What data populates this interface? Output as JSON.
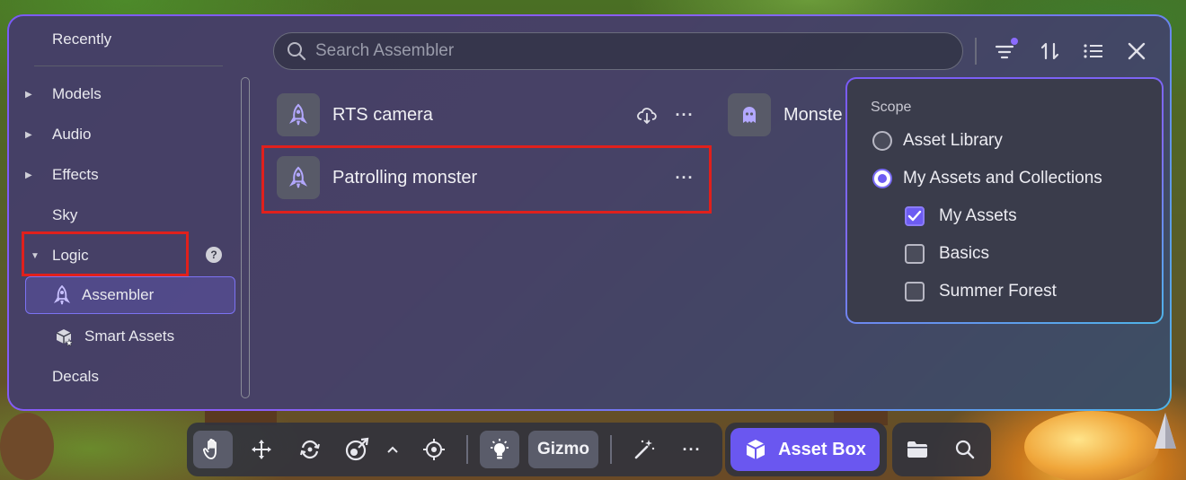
{
  "sidebar": {
    "recently": "Recently",
    "items": [
      {
        "label": "Models",
        "expandable": true
      },
      {
        "label": "Audio",
        "expandable": true
      },
      {
        "label": "Effects",
        "expandable": true
      },
      {
        "label": "Sky",
        "expandable": false
      },
      {
        "label": "Logic",
        "expanded": true
      }
    ],
    "logic_children": [
      {
        "label": "Assembler",
        "icon": "rocket-icon",
        "selected": true
      },
      {
        "label": "Smart Assets",
        "icon": "smart-assets-icon"
      }
    ],
    "decals": "Decals",
    "help": "?"
  },
  "search": {
    "placeholder": "Search Assembler"
  },
  "assets": [
    {
      "name": "RTS camera",
      "icon": "rocket-icon"
    },
    {
      "name": "Monste",
      "icon": "ghost-icon"
    },
    {
      "name": "Patrolling monster",
      "icon": "rocket-icon"
    }
  ],
  "scope": {
    "title": "Scope",
    "options": [
      {
        "label": "Asset Library",
        "selected": false
      },
      {
        "label": "My Assets and Collections",
        "selected": true
      }
    ],
    "collections": [
      {
        "label": "My Assets",
        "checked": true
      },
      {
        "label": "Basics",
        "checked": false
      },
      {
        "label": "Summer Forest",
        "checked": false
      }
    ]
  },
  "toolbar": {
    "gizmo_label": "Gizmo",
    "asset_box_label": "Asset Box"
  },
  "colors": {
    "accent": "#6a57f0",
    "highlight": "#e0201c",
    "panel_border": "#7a5af8"
  }
}
